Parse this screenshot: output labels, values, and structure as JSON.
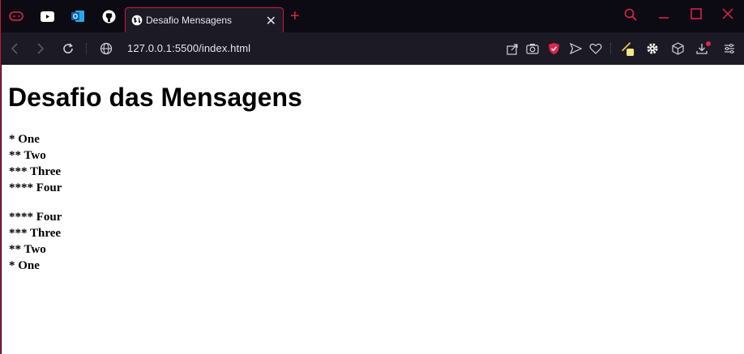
{
  "browser": {
    "tab": {
      "title": "Desafio Mensagens"
    },
    "address_bar": {
      "url": "127.0.0.1:5500/index.html"
    }
  },
  "page": {
    "heading": "Desafio das Mensagens",
    "list_ascending": [
      "* One",
      "** Two",
      "*** Three",
      "**** Four"
    ],
    "list_descending": [
      "**** Four",
      "*** Three",
      "** Two",
      "* One"
    ]
  },
  "colors": {
    "accent": "#e0254a",
    "tabstrip_bg": "#0c0b13",
    "toolbar_bg": "#1b1a25",
    "page_bg": "#ffffff"
  }
}
